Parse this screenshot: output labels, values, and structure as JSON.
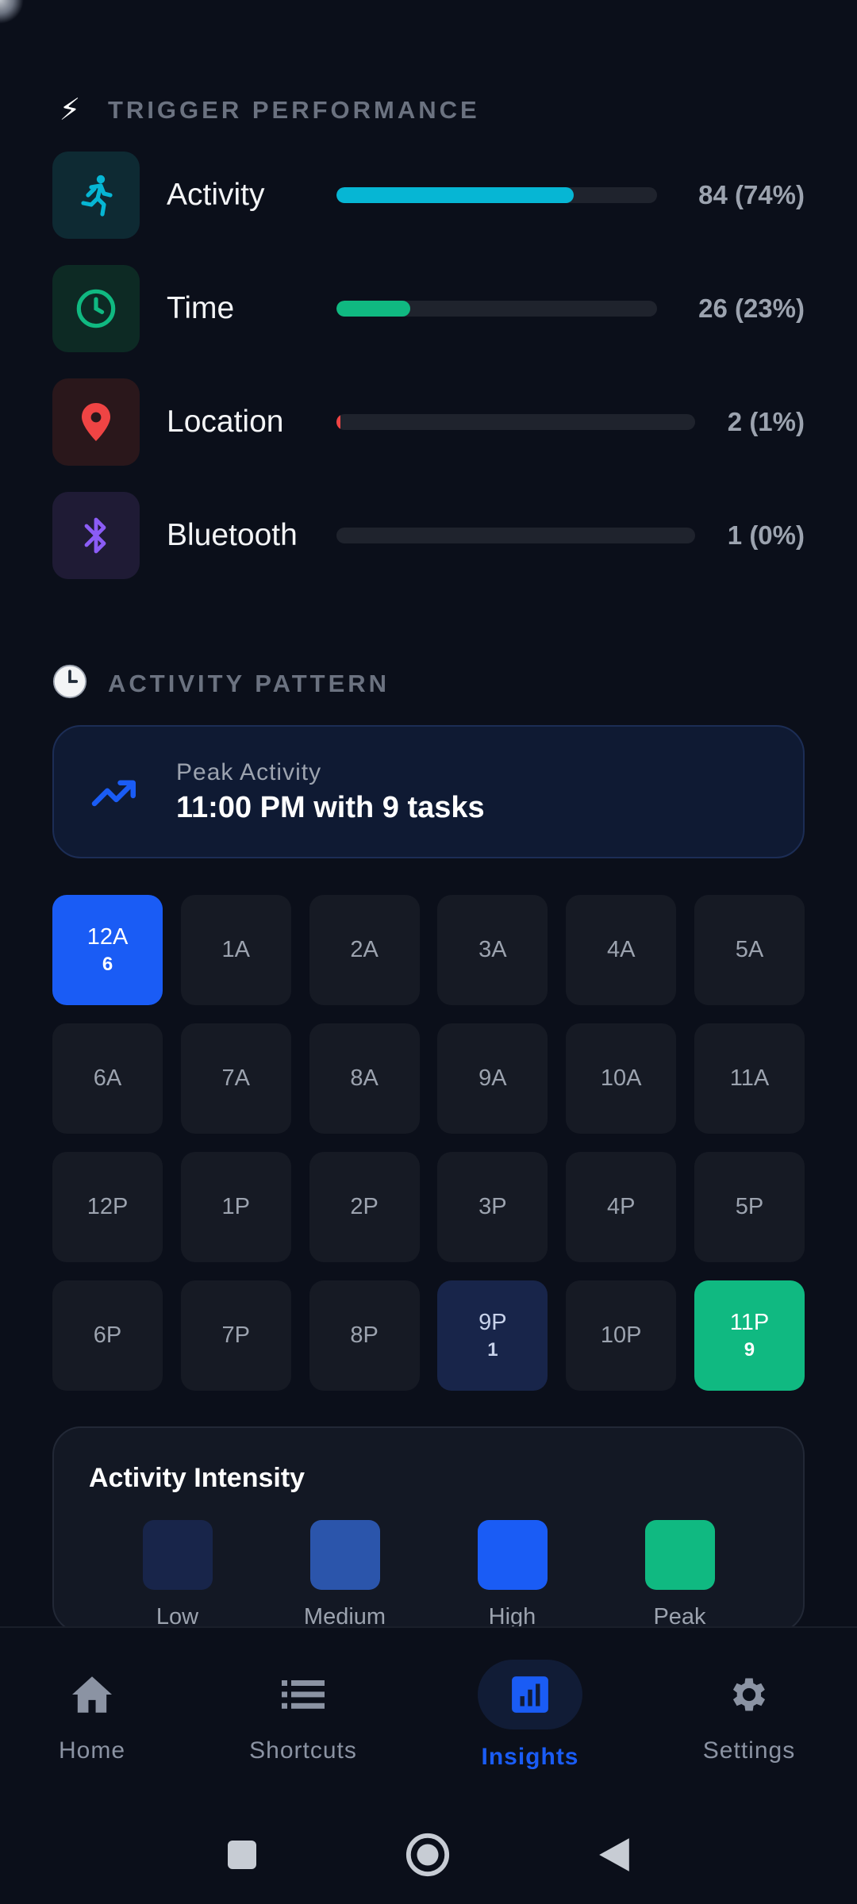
{
  "trigger_section": {
    "icon": "lightning-icon",
    "title": "TRIGGER PERFORMANCE",
    "items": [
      {
        "label": "Activity",
        "icon": "running-person-icon",
        "count_text": "84 (74%)",
        "share": 0.74,
        "color": "#06b6d4",
        "icon_bg": "#0e2a33"
      },
      {
        "label": "Time",
        "icon": "clock-icon",
        "count_text": "26 (23%)",
        "share": 0.23,
        "color": "#10b981",
        "icon_bg": "#0d2a24"
      },
      {
        "label": "Location",
        "icon": "map-pin-icon",
        "count_text": "2 (1%)",
        "share": 0.01,
        "color": "#ef4444",
        "icon_bg": "#2a171b"
      },
      {
        "label": "Bluetooth",
        "icon": "bluetooth-icon",
        "count_text": "1 (0%)",
        "share": 0.0,
        "color": "#8b5cf6",
        "icon_bg": "#1f1b35"
      }
    ]
  },
  "activity_section": {
    "icon": "clock-emoji-icon",
    "title": "ACTIVITY PATTERN",
    "peak": {
      "label": "Peak Activity",
      "value": "11:00 PM with 9 tasks",
      "icon": "trending-up-icon"
    },
    "hours": [
      {
        "label": "12A",
        "count": "6",
        "level": "high"
      },
      {
        "label": "1A",
        "count": "",
        "level": "none"
      },
      {
        "label": "2A",
        "count": "",
        "level": "none"
      },
      {
        "label": "3A",
        "count": "",
        "level": "none"
      },
      {
        "label": "4A",
        "count": "",
        "level": "none"
      },
      {
        "label": "5A",
        "count": "",
        "level": "none"
      },
      {
        "label": "6A",
        "count": "",
        "level": "none"
      },
      {
        "label": "7A",
        "count": "",
        "level": "none"
      },
      {
        "label": "8A",
        "count": "",
        "level": "none"
      },
      {
        "label": "9A",
        "count": "",
        "level": "none"
      },
      {
        "label": "10A",
        "count": "",
        "level": "none"
      },
      {
        "label": "11A",
        "count": "",
        "level": "none"
      },
      {
        "label": "12P",
        "count": "",
        "level": "none"
      },
      {
        "label": "1P",
        "count": "",
        "level": "none"
      },
      {
        "label": "2P",
        "count": "",
        "level": "none"
      },
      {
        "label": "3P",
        "count": "",
        "level": "none"
      },
      {
        "label": "4P",
        "count": "",
        "level": "none"
      },
      {
        "label": "5P",
        "count": "",
        "level": "none"
      },
      {
        "label": "6P",
        "count": "",
        "level": "none"
      },
      {
        "label": "7P",
        "count": "",
        "level": "none"
      },
      {
        "label": "8P",
        "count": "",
        "level": "none"
      },
      {
        "label": "9P",
        "count": "1",
        "level": "low"
      },
      {
        "label": "10P",
        "count": "",
        "level": "none"
      },
      {
        "label": "11P",
        "count": "9",
        "level": "peak"
      }
    ],
    "intensity": {
      "title": "Activity Intensity",
      "legend": [
        {
          "label": "Low",
          "color": "#18254a"
        },
        {
          "label": "Medium",
          "color": "#2b55ab"
        },
        {
          "label": "High",
          "color": "#1a5cf5"
        },
        {
          "label": "Peak",
          "color": "#10b981"
        }
      ]
    }
  },
  "bottom_nav": {
    "items": [
      {
        "label": "Home",
        "icon": "home-icon",
        "active": false
      },
      {
        "label": "Shortcuts",
        "icon": "list-icon",
        "active": false
      },
      {
        "label": "Insights",
        "icon": "bar-chart-icon",
        "active": true
      },
      {
        "label": "Settings",
        "icon": "gear-icon",
        "active": false
      }
    ],
    "accent": "#1a5cf5"
  },
  "system_nav": {
    "buttons": [
      "recents-square-icon",
      "home-circle-icon",
      "back-triangle-icon"
    ]
  }
}
